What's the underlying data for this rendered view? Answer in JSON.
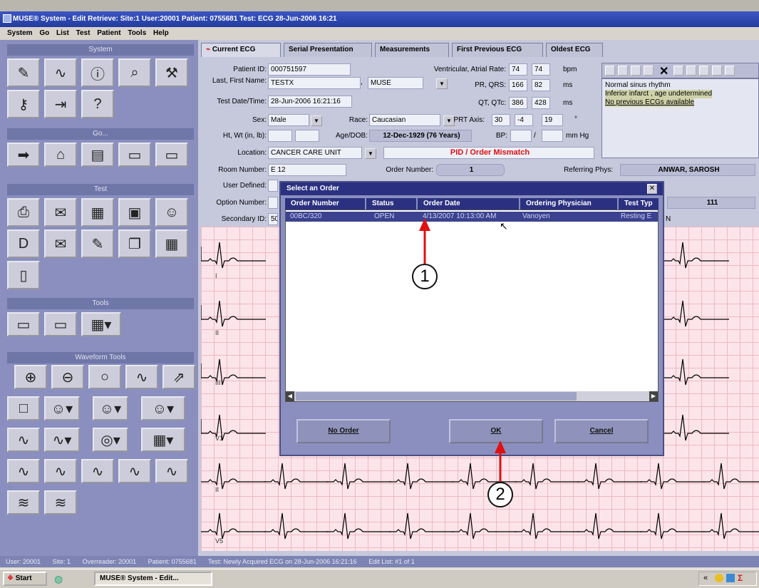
{
  "window": {
    "title": "MUSE® System - Edit Retrieve: Site:1 User:20001 Patient: 0755681 Test: ECG 28-Jun-2006 16:21"
  },
  "menu": [
    "System",
    "Go",
    "List",
    "Test",
    "Patient",
    "Tools",
    "Help"
  ],
  "sections": {
    "system": "System",
    "go": "Go...",
    "test": "Test",
    "tools": "Tools",
    "waveform": "Waveform Tools"
  },
  "tabs": [
    "Current ECG",
    "Serial Presentation",
    "Measurements",
    "First Previous ECG",
    "Oldest ECG"
  ],
  "patient": {
    "id_label": "Patient ID:",
    "id": "000751597",
    "name_label": "Last, First Name:",
    "last": "TESTX",
    "first": "MUSE",
    "dt_label": "Test Date/Time:",
    "dt": "28-Jun-2006 16:21:16",
    "sex_label": "Sex:",
    "sex": "Male",
    "race_label": "Race:",
    "race": "Caucasian",
    "htwt_label": "Ht, Wt (in, lb):",
    "age_label": "Age/DOB:",
    "age": "12-Dec-1929 (76 Years)",
    "bp_label": "BP:",
    "bp_unit": "mm Hg",
    "loc_label": "Location:",
    "loc": "CANCER CARE UNIT",
    "mismatch": "PID / Order Mismatch",
    "room_label": "Room Number:",
    "room": "E 12",
    "order_label": "Order Number:",
    "order": "1",
    "ref_label": "Referring Phys:",
    "ref": "ANWAR, SAROSH",
    "user_label": "User Defined:",
    "option_label": "Option Number:",
    "option_val": "111",
    "secondary_label": "Secondary ID:",
    "secondary": "50"
  },
  "measures": {
    "rate_label": "Ventricular, Atrial Rate:",
    "rate_v": "74",
    "rate_a": "74",
    "rate_unit": "bpm",
    "prqrs_label": "PR, QRS:",
    "pr": "166",
    "qrs": "82",
    "prqrs_unit": "ms",
    "qt_label": "QT, QTc:",
    "qt": "386",
    "qtc": "428",
    "qt_unit": "ms",
    "axis_label": "PRT Axis:",
    "p_axis": "30",
    "r_axis": "-4",
    "t_axis": "19",
    "axis_unit": "°"
  },
  "interpretation": [
    "Normal sinus rhythm",
    "Inferior infarct , age undetermined",
    "No previous ECGs available"
  ],
  "leads": [
    "I",
    "II",
    "III",
    "V1",
    "II",
    "V5"
  ],
  "dialog": {
    "title": "Select an Order",
    "headers": [
      "Order Number",
      "Status",
      "Order Date",
      "Ordering Physician",
      "Test Typ"
    ],
    "row": {
      "order": "00BC/320",
      "status": "OPEN",
      "date": "4/13/2007 10:13:00 AM",
      "physician": "Vanoyen",
      "test": "Resting E"
    },
    "buttons": {
      "no_order": "No Order",
      "ok": "OK",
      "cancel": "Cancel"
    }
  },
  "callouts": [
    "1",
    "2"
  ],
  "status": [
    "User: 20001",
    "Site: 1",
    "Overreader: 20001",
    "Patient: 0755681",
    "Test: Newly Acquired ECG on 28-Jun-2006 16:21:16",
    "Edit List: #1 of 1"
  ],
  "taskbar": {
    "start": "Start",
    "task": "MUSE® System - Edit..."
  }
}
